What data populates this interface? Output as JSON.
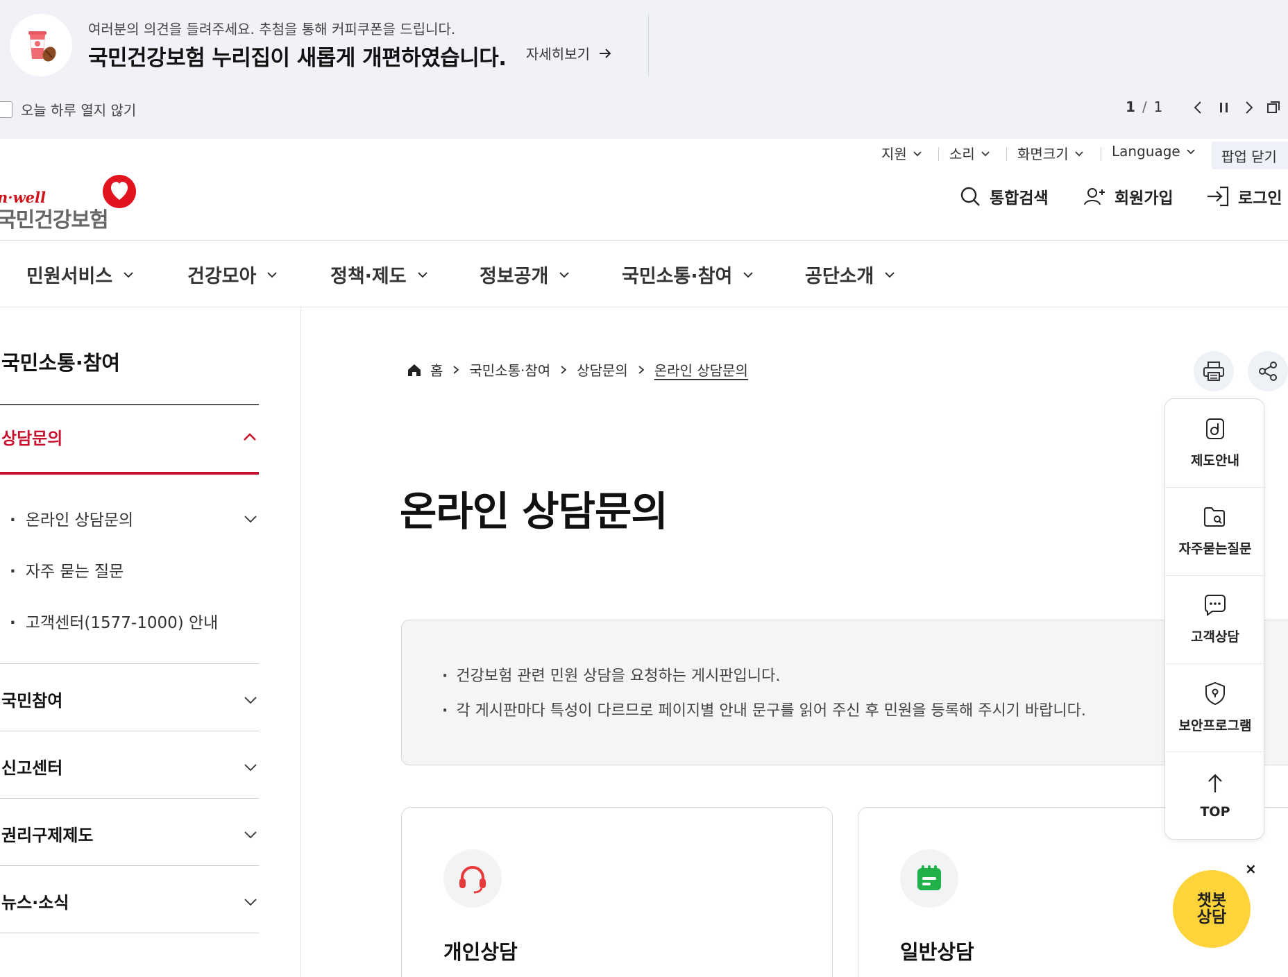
{
  "popup": {
    "subtitle": "여러분의 의견을 들려주세요. 추첨을 통해 커피쿠폰을 드립니다.",
    "title": "국민건강보험 누리집이 새롭게 개편하였습니다.",
    "more_label": "자세히보기",
    "dont_show_label": "오늘 하루 열지 않기",
    "pager_current": "1",
    "pager_sep": "/",
    "pager_total": "1"
  },
  "utility": {
    "support": "지원",
    "sound": "소리",
    "screen_size": "화면크기",
    "language": "Language",
    "popup_close": "팝업 닫기"
  },
  "brand": {
    "en": "n·well",
    "ko": "국민건강보험"
  },
  "header": {
    "search": "통합검색",
    "signup": "회원가입",
    "login": "로그인"
  },
  "gnb": [
    "민원서비스",
    "건강모아",
    "정책·제도",
    "정보공개",
    "국민소통·참여",
    "공단소개"
  ],
  "lnb": {
    "title": "국민소통·참여",
    "active": "상담문의",
    "sub_items": [
      "온라인 상담문의",
      "자주 묻는 질문",
      "고객센터(1577-1000) 안내"
    ],
    "groups": [
      "국민참여",
      "신고센터",
      "권리구제제도",
      "뉴스·소식"
    ]
  },
  "breadcrumb": {
    "home": "홈",
    "items": [
      "국민소통·참여",
      "상담문의"
    ],
    "current": "온라인 상담문의"
  },
  "page_title": "온라인 상담문의",
  "notice": [
    "건강보험 관련 민원 상담을 요청하는 게시판입니다.",
    "각 게시판마다 특성이 다르므로 페이지별 안내 문구를 읽어 주신 후 민원을 등록해 주시기 바랍니다."
  ],
  "cards": [
    {
      "title": "개인상담",
      "icon": "headset-icon"
    },
    {
      "title": "일반상담",
      "icon": "calendar-icon"
    }
  ],
  "quick_menu": [
    "제도안내",
    "자주묻는질문",
    "고객상담",
    "보안프로그램",
    "TOP"
  ],
  "chatbot": {
    "line1": "챗봇",
    "line2": "상담",
    "close": "×"
  },
  "colors": {
    "brand_red": "#c8102e",
    "popup_bg": "#f0f2f7",
    "chatbot_yellow": "#ffd43b",
    "calendar_green": "#21b14b"
  }
}
